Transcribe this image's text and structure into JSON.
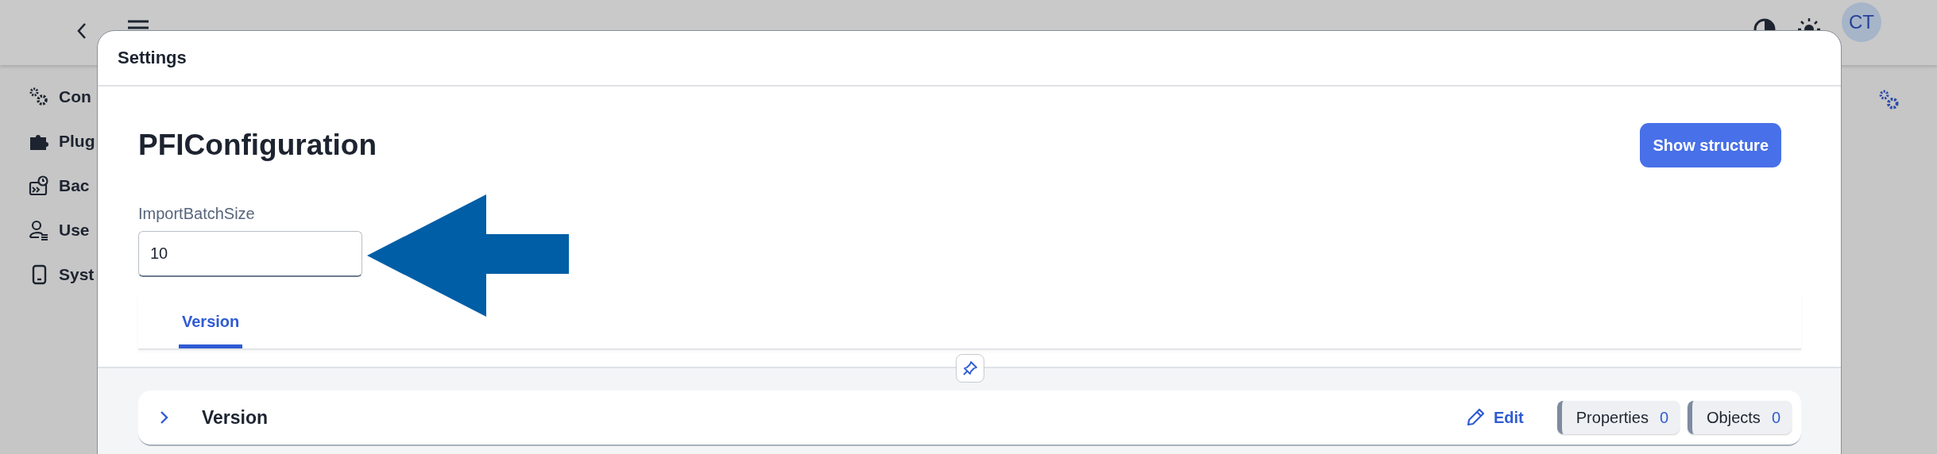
{
  "app": {
    "avatar": "CT",
    "sidebar": [
      {
        "label": "Con"
      },
      {
        "label": "Plug"
      },
      {
        "label": "Bac"
      },
      {
        "label": "Use"
      },
      {
        "label": "Syst"
      }
    ]
  },
  "dialog": {
    "title": "Settings",
    "heading": "PFIConfiguration",
    "action": "Show structure",
    "field": {
      "label": "ImportBatchSize",
      "value": "10"
    },
    "tabs": [
      {
        "label": "Version",
        "selected": true
      }
    ],
    "panels": [
      {
        "title": "Version",
        "expanded": false,
        "edit": "Edit",
        "counters": [
          {
            "label": "Properties",
            "count": "0"
          },
          {
            "label": "Objects",
            "count": "0"
          }
        ]
      }
    ]
  }
}
